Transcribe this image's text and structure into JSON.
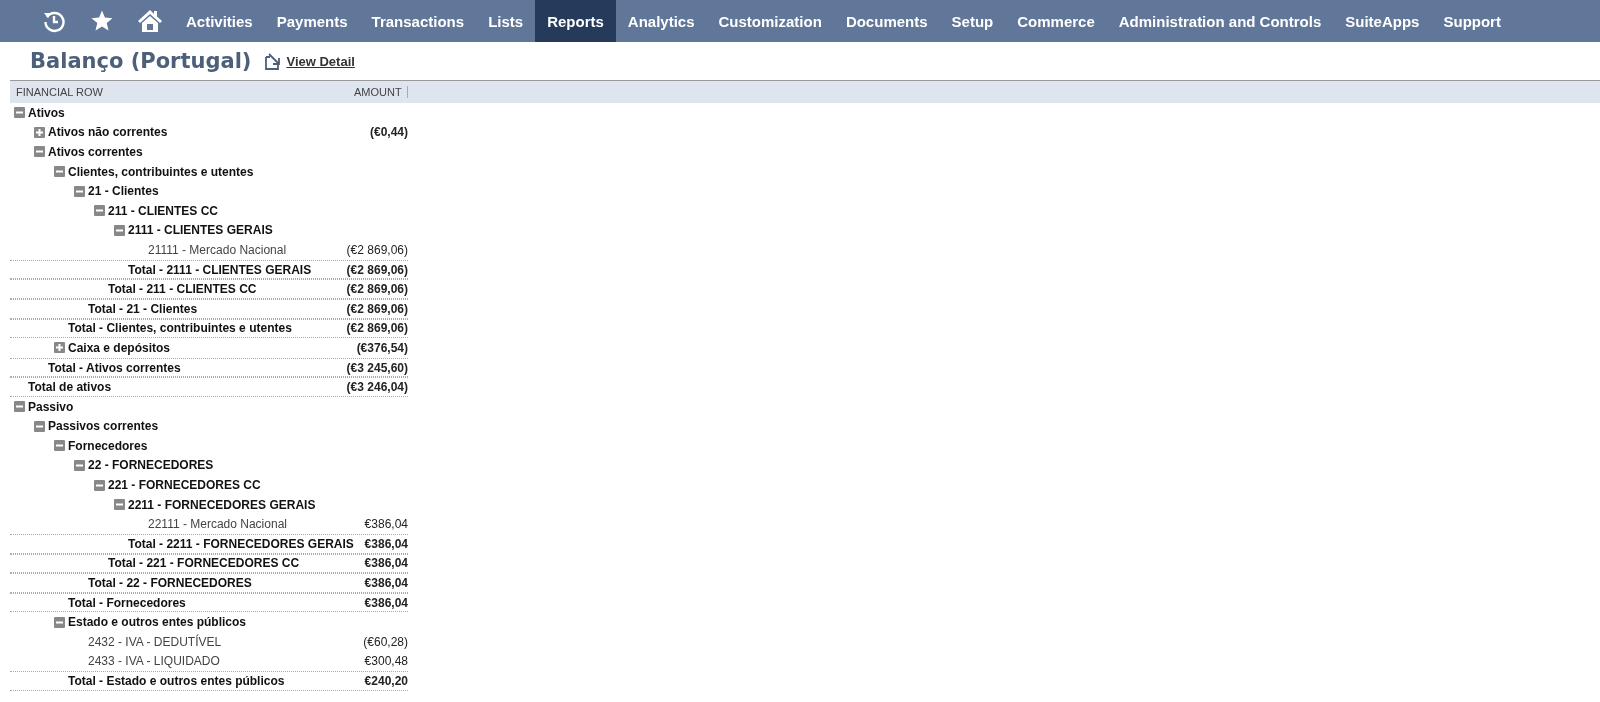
{
  "nav": {
    "icon_items": [
      {
        "kind": "recent"
      },
      {
        "kind": "favorites"
      },
      {
        "kind": "home"
      }
    ],
    "tabs": [
      {
        "label": "Activities",
        "selected": false
      },
      {
        "label": "Payments",
        "selected": false
      },
      {
        "label": "Transactions",
        "selected": false
      },
      {
        "label": "Lists",
        "selected": false
      },
      {
        "label": "Reports",
        "selected": true
      },
      {
        "label": "Analytics",
        "selected": false
      },
      {
        "label": "Customization",
        "selected": false
      },
      {
        "label": "Documents",
        "selected": false
      },
      {
        "label": "Setup",
        "selected": false
      },
      {
        "label": "Commerce",
        "selected": false
      },
      {
        "label": "Administration and Controls",
        "selected": false
      },
      {
        "label": "SuiteApps",
        "selected": false
      },
      {
        "label": "Support",
        "selected": false
      }
    ]
  },
  "page": {
    "title": "Balanço (Portugal)",
    "view_detail_link": "View Detail"
  },
  "table": {
    "columns": [
      "FINANCIAL ROW",
      "AMOUNT"
    ],
    "rows": [
      {
        "label": "Ativos",
        "expanded": true,
        "total": {
          "label": "Total de ativos",
          "amount": "(€3 246,04)"
        },
        "children": [
          {
            "label": "Ativos não correntes",
            "expanded": false,
            "amount": "(€0,44)"
          },
          {
            "label": "Ativos correntes",
            "expanded": true,
            "total": {
              "label": "Total - Ativos correntes",
              "amount": "(€3 245,60)"
            },
            "children": [
              {
                "label": "Clientes, contribuintes e utentes",
                "expanded": true,
                "total": {
                  "label": "Total - Clientes, contribuintes e utentes",
                  "amount": "(€2 869,06)"
                },
                "children": [
                  {
                    "label": "21 - Clientes",
                    "expanded": true,
                    "total": {
                      "label": "Total - 21 - Clientes",
                      "amount": "(€2 869,06)"
                    },
                    "children": [
                      {
                        "label": "211 - CLIENTES CC",
                        "expanded": true,
                        "total": {
                          "label": "Total - 211 - CLIENTES CC",
                          "amount": "(€2 869,06)"
                        },
                        "children": [
                          {
                            "label": "2111 - CLIENTES GERAIS",
                            "expanded": true,
                            "total": {
                              "label": "Total - 2111 - CLIENTES GERAIS",
                              "amount": "(€2 869,06)"
                            },
                            "children": [
                              {
                                "label": "21111 - Mercado Nacional",
                                "amount": "(€2 869,06)"
                              }
                            ]
                          }
                        ]
                      }
                    ]
                  }
                ]
              },
              {
                "label": "Caixa e depósitos",
                "expanded": false,
                "amount": "(€376,54)"
              }
            ]
          }
        ]
      },
      {
        "label": "Passivo",
        "expanded": true,
        "children": [
          {
            "label": "Passivos correntes",
            "expanded": true,
            "children": [
              {
                "label": "Fornecedores",
                "expanded": true,
                "total": {
                  "label": "Total - Fornecedores",
                  "amount": "€386,04"
                },
                "children": [
                  {
                    "label": "22 - FORNECEDORES",
                    "expanded": true,
                    "total": {
                      "label": "Total - 22 - FORNECEDORES",
                      "amount": "€386,04"
                    },
                    "children": [
                      {
                        "label": "221 - FORNECEDORES CC",
                        "expanded": true,
                        "total": {
                          "label": "Total - 221 - FORNECEDORES CC",
                          "amount": "€386,04"
                        },
                        "children": [
                          {
                            "label": "2211 - FORNECEDORES GERAIS",
                            "expanded": true,
                            "total": {
                              "label": "Total - 2211 - FORNECEDORES GERAIS",
                              "amount": "€386,04"
                            },
                            "children": [
                              {
                                "label": "22111 - Mercado Nacional",
                                "amount": "€386,04"
                              }
                            ]
                          }
                        ]
                      }
                    ]
                  }
                ]
              },
              {
                "label": "Estado e outros entes públicos",
                "expanded": true,
                "total": {
                  "label": "Total - Estado e outros entes públicos",
                  "amount": "€240,20"
                },
                "children": [
                  {
                    "label": "2432 - IVA - DEDUTÍVEL",
                    "amount": "(€60,28)"
                  },
                  {
                    "label": "2433 - IVA - LIQUIDADO",
                    "amount": "€300,48"
                  }
                ]
              }
            ]
          }
        ]
      }
    ]
  }
}
